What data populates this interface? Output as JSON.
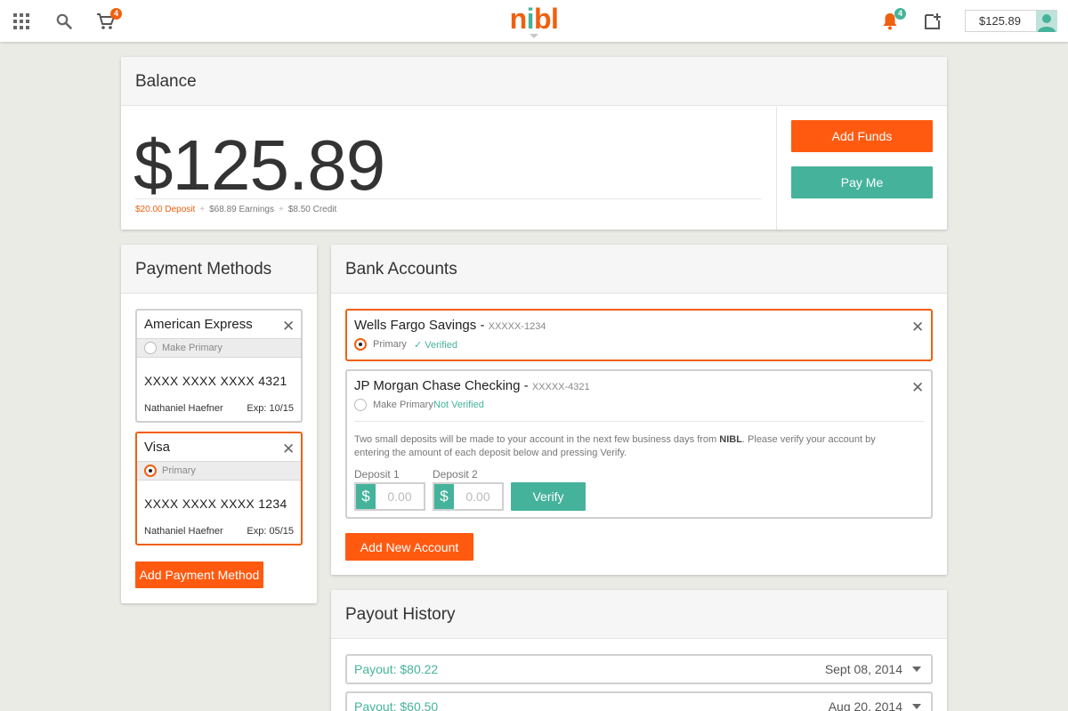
{
  "header": {
    "brand_letters": [
      "n",
      "i",
      "b",
      "l"
    ],
    "brand_colors": [
      "#f0600f",
      "#45b39b",
      "#f0600f",
      "#f0600f"
    ],
    "cart_count": "4",
    "notification_count": "4",
    "balance": "$125.89",
    "icons": [
      "apps-grid-icon",
      "search-icon",
      "cart-icon",
      "bell-icon",
      "add-item-icon",
      "avatar-icon"
    ]
  },
  "balance_card": {
    "title": "Balance",
    "amount": "$125.89",
    "breakdown": {
      "deposit": "$20.00 Deposit",
      "earnings": "$68.89 Earnings",
      "credit": "$8.50 Credit",
      "separator": "+"
    },
    "add_funds_label": "Add Funds",
    "pay_me_label": "Pay Me"
  },
  "payment_methods": {
    "title": "Payment Methods",
    "cards": [
      {
        "brand": "American Express",
        "status": "Make Primary",
        "number": "XXXX XXXX XXXX 4321",
        "holder": "Nathaniel Haefner",
        "exp": "Exp: 10/15",
        "selected": false
      },
      {
        "brand": "Visa",
        "status": "Primary",
        "number": "XXXX XXXX XXXX 1234",
        "holder": "Nathaniel Haefner",
        "exp": "Exp: 05/15",
        "selected": true
      }
    ],
    "add_label": "Add Payment Method"
  },
  "bank_accounts": {
    "title": "Bank Accounts",
    "accounts": [
      {
        "name": "Wells Fargo Savings - ",
        "mask": "XXXXX-1234",
        "status": "Primary",
        "verification": "✓ Verified",
        "selected": true
      },
      {
        "name": "JP Morgan Chase Checking - ",
        "mask": "XXXXX-4321",
        "status": "Make Primary",
        "verification": "Not Verified",
        "selected": false
      }
    ],
    "verify_note_pre": "Two small deposits will be made to your account in the next few business days from ",
    "verify_note_brand": "NIBL",
    "verify_note_post": ". Please verify your account by entering the amount of each deposit below and pressing Verify.",
    "deposit1_label": "Deposit 1",
    "deposit2_label": "Deposit 2",
    "currency_symbol": "$",
    "deposit_placeholder": "0.00",
    "verify_label": "Verify",
    "add_label": "Add New Account"
  },
  "payout_history": {
    "title": "Payout History",
    "rows": [
      {
        "amount": "Payout: $80.22",
        "date": "Sept 08, 2014"
      },
      {
        "amount": "Payout: $60.50",
        "date": "Aug 20, 2014"
      }
    ]
  },
  "colors": {
    "accent_orange": "#ff5a10",
    "accent_teal": "#45b39b",
    "page_bg": "#ebebe6"
  }
}
